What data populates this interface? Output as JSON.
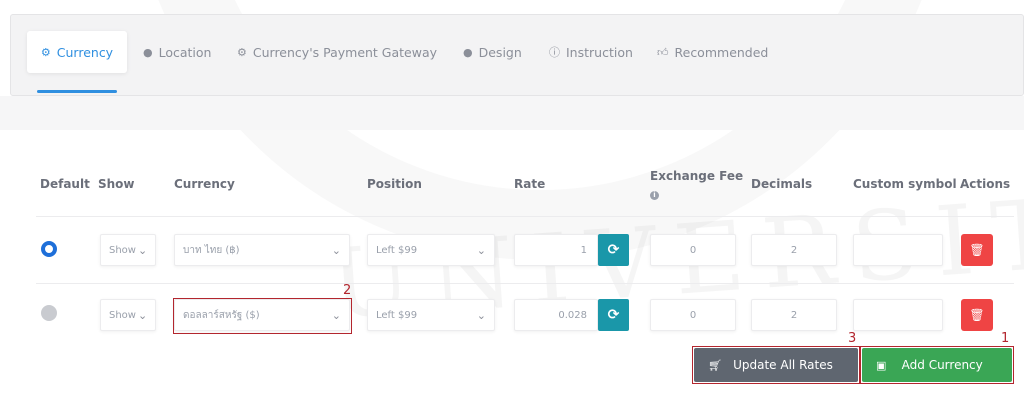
{
  "tabs": [
    {
      "label": "Currency",
      "icon": "gear-icon",
      "active": true
    },
    {
      "label": "Location",
      "icon": "globe-icon"
    },
    {
      "label": "Currency's Payment Gateway",
      "icon": "gear-icon"
    },
    {
      "label": "Design",
      "icon": "globe-icon"
    },
    {
      "label": "Instruction",
      "icon": "info-icon"
    },
    {
      "label": "Recommended",
      "icon": "thumbs-up-icon"
    }
  ],
  "table": {
    "headers": {
      "default": "Default",
      "show": "Show",
      "currency": "Currency",
      "position": "Position",
      "rate": "Rate",
      "exchange_fee": "Exchange Fee",
      "decimals": "Decimals",
      "custom_symbol": "Custom symbol",
      "actions": "Actions"
    },
    "rows": [
      {
        "default": true,
        "show": "Show",
        "currency": "บาท ไทย (฿)",
        "position": "Left $99",
        "rate": "1",
        "exchange_fee": "0",
        "decimals": "2",
        "custom_symbol": ""
      },
      {
        "default": false,
        "show": "Show",
        "currency": "ดอลลาร์สหรัฐ ($)",
        "position": "Left $99",
        "rate": "0.028",
        "exchange_fee": "0",
        "decimals": "2",
        "custom_symbol": ""
      }
    ]
  },
  "actions": {
    "update_all_rates": "Update All Rates",
    "add_currency": "Add Currency"
  },
  "annotations": {
    "marker_1": "1",
    "marker_2": "2",
    "marker_3": "3"
  },
  "colors": {
    "accent": "#2f8fe0",
    "refresh": "#1a97a9",
    "delete": "#ef4444",
    "update_button": "#5f6670",
    "add_button": "#3aa655",
    "annotation": "#b3262e"
  }
}
